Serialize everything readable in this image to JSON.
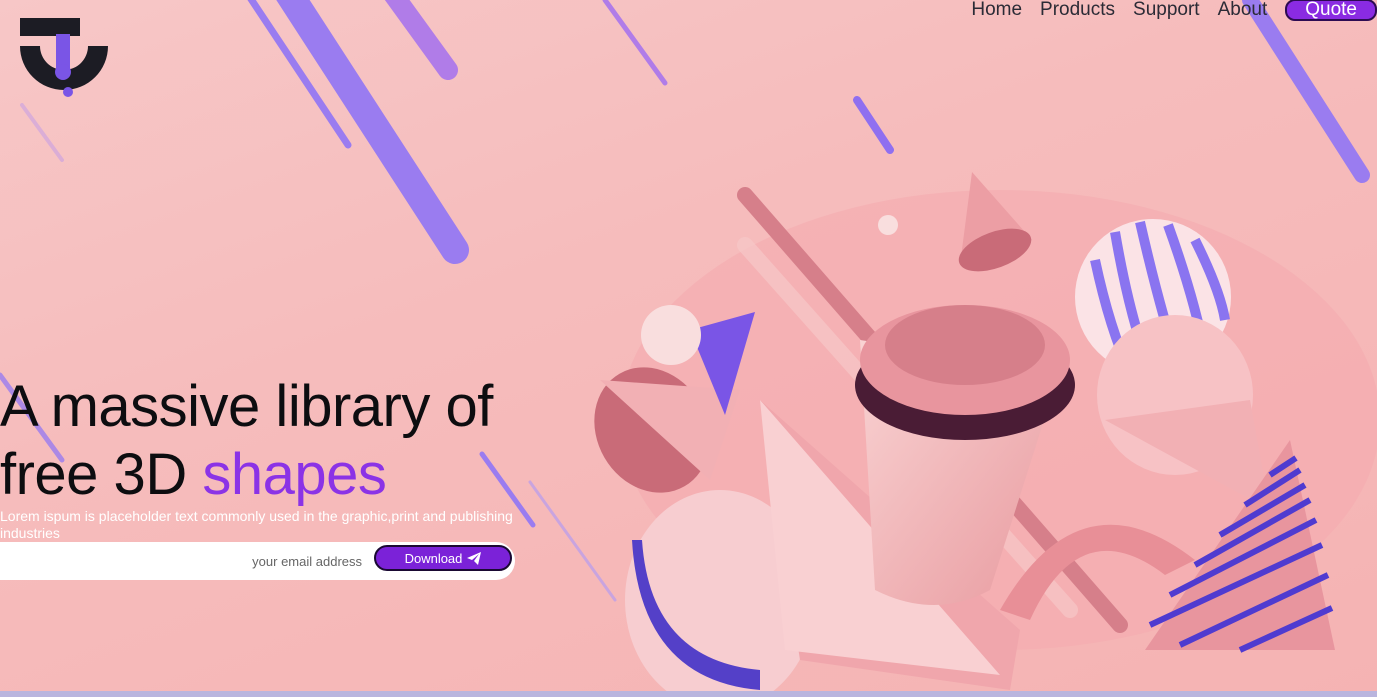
{
  "nav": {
    "items": [
      "Home",
      "Products",
      "Support",
      "About"
    ],
    "quote_label": "Quote"
  },
  "hero": {
    "headline_part1": "A massive library of",
    "headline_part2": "free 3D ",
    "headline_accent": "shapes",
    "subtitle": "Lorem ispum is placeholder text commonly used in the graphic,print and publishing industries",
    "email_placeholder": "your email address",
    "download_label": "Download"
  },
  "colors": {
    "accent": "#8b33e6",
    "button": "#7b22d8",
    "background": "#f6bcbc",
    "stripe": "#9a7cf0"
  },
  "icons": {
    "logo": "brand-logo",
    "download": "paper-plane-icon"
  }
}
